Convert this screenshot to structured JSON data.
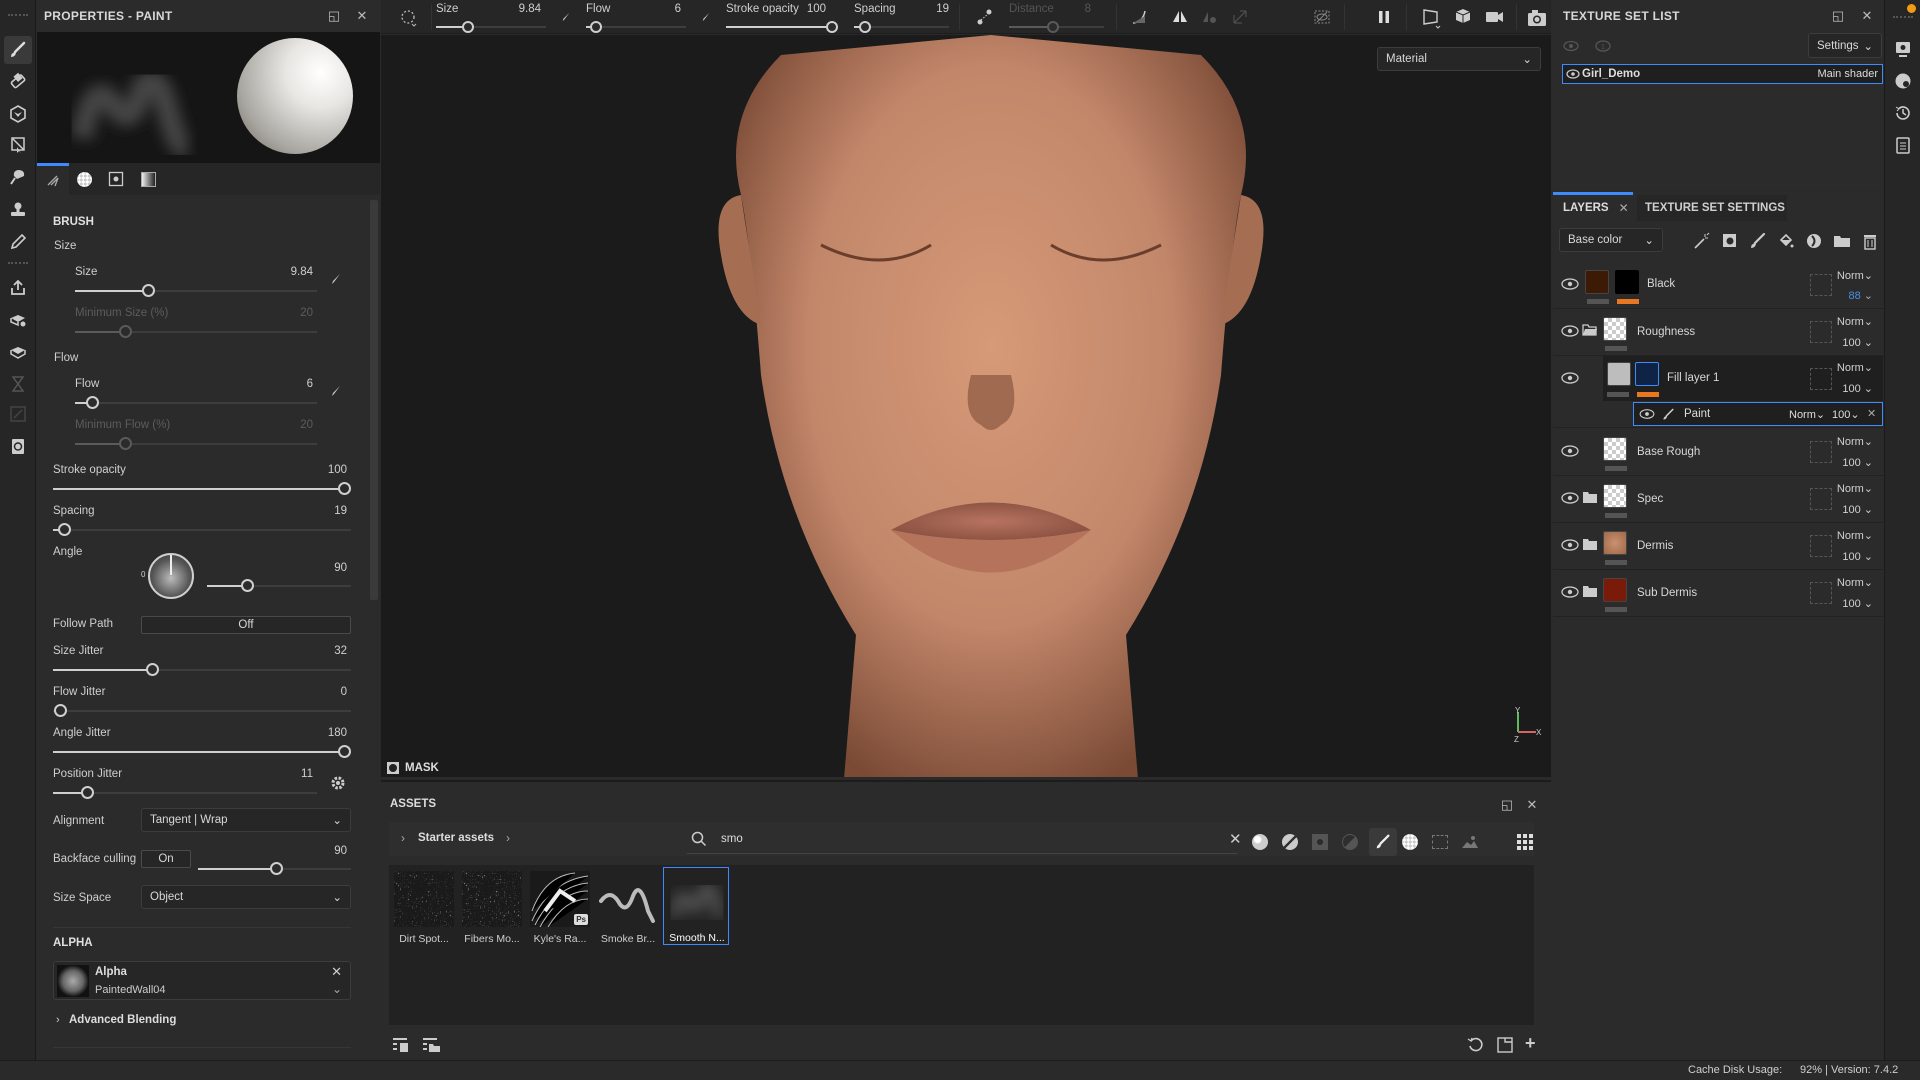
{
  "properties": {
    "title": "PROPERTIES - PAINT",
    "brush_section": "BRUSH",
    "size_group": "Size",
    "size": {
      "label": "Size",
      "value": "9.84",
      "fraction": 0.33
    },
    "min_size": {
      "label": "Minimum Size (%)",
      "value": "20",
      "fraction": 0.2
    },
    "flow_group": "Flow",
    "flow": {
      "label": "Flow",
      "value": "6",
      "fraction": 0.06
    },
    "min_flow": {
      "label": "Minimum Flow (%)",
      "value": "20",
      "fraction": 0.2
    },
    "stroke_opacity": {
      "label": "Stroke opacity",
      "value": "100",
      "fraction": 1.0
    },
    "spacing": {
      "label": "Spacing",
      "value": "19",
      "fraction": 0.04
    },
    "angle": {
      "label": "Angle",
      "value": "90",
      "dial_zero": "0",
      "fraction": 0.25
    },
    "follow_path": {
      "label": "Follow Path",
      "value": "Off"
    },
    "size_jitter": {
      "label": "Size Jitter",
      "value": "32",
      "fraction": 0.32
    },
    "flow_jitter": {
      "label": "Flow Jitter",
      "value": "0",
      "fraction": 0.0
    },
    "angle_jitter": {
      "label": "Angle Jitter",
      "value": "180",
      "fraction": 1.0
    },
    "position_jitter": {
      "label": "Position Jitter",
      "value": "11",
      "fraction": 0.11
    },
    "alignment": {
      "label": "Alignment",
      "value": "Tangent | Wrap"
    },
    "backface_culling": {
      "label": "Backface culling",
      "toggle": "On",
      "value": "90",
      "fraction": 0.5
    },
    "size_space": {
      "label": "Size Space",
      "value": "Object"
    },
    "alpha_section": "ALPHA",
    "alpha": {
      "title": "Alpha",
      "name": "PaintedWall04"
    },
    "advanced_blending": "Advanced Blending"
  },
  "topbar": {
    "size": {
      "label": "Size",
      "value": "9.84"
    },
    "flow": {
      "label": "Flow",
      "value": "6"
    },
    "stroke_opacity": {
      "label": "Stroke opacity",
      "value": "100"
    },
    "spacing": {
      "label": "Spacing",
      "value": "19"
    },
    "distance": {
      "label": "Distance",
      "value": "8"
    }
  },
  "viewport": {
    "material_select": "Material",
    "mask_label": "MASK",
    "gizmo": {
      "x": "X",
      "y": "Y",
      "z": "Z"
    }
  },
  "assets": {
    "title": "ASSETS",
    "breadcrumb": "Starter assets",
    "search_value": "smo",
    "items": [
      {
        "label": "Dirt Spot...",
        "selected": false
      },
      {
        "label": "Fibers Mo...",
        "selected": false
      },
      {
        "label": "Kyle's Ra...",
        "selected": false,
        "badge": "Ps"
      },
      {
        "label": "Smoke Br...",
        "selected": false
      },
      {
        "label": "Smooth N...",
        "selected": true
      }
    ]
  },
  "texture_set_list": {
    "title": "TEXTURE SET LIST",
    "settings_label": "Settings",
    "items": [
      {
        "name": "Girl_Demo",
        "shader": "Main shader"
      }
    ]
  },
  "layers": {
    "tab_layers": "LAYERS",
    "tab_tss": "TEXTURE SET SETTINGS",
    "channel": "Base color",
    "rows": [
      {
        "name": "Black",
        "blend": "Norm",
        "opacity": "88",
        "type": "fill"
      },
      {
        "name": "Roughness",
        "blend": "Norm",
        "opacity": "100",
        "type": "folder"
      },
      {
        "name": "Fill layer 1",
        "blend": "Norm",
        "opacity": "100",
        "type": "fill"
      },
      {
        "name": "Base Rough",
        "blend": "Norm",
        "opacity": "100",
        "type": "layer"
      },
      {
        "name": "Spec",
        "blend": "Norm",
        "opacity": "100",
        "type": "folder"
      },
      {
        "name": "Dermis",
        "blend": "Norm",
        "opacity": "100",
        "type": "folder"
      },
      {
        "name": "Sub Dermis",
        "blend": "Norm",
        "opacity": "100",
        "type": "folder"
      }
    ],
    "effect": {
      "name": "Paint",
      "blend": "Norm",
      "opacity": "100"
    }
  },
  "status": {
    "cache_label": "Cache Disk Usage:",
    "cache_value": "92% | Version: 7.4.2"
  },
  "colors": {
    "accent": "#3d8bfd",
    "orange": "#e87722",
    "opacity_blue": "#4a90e2"
  }
}
